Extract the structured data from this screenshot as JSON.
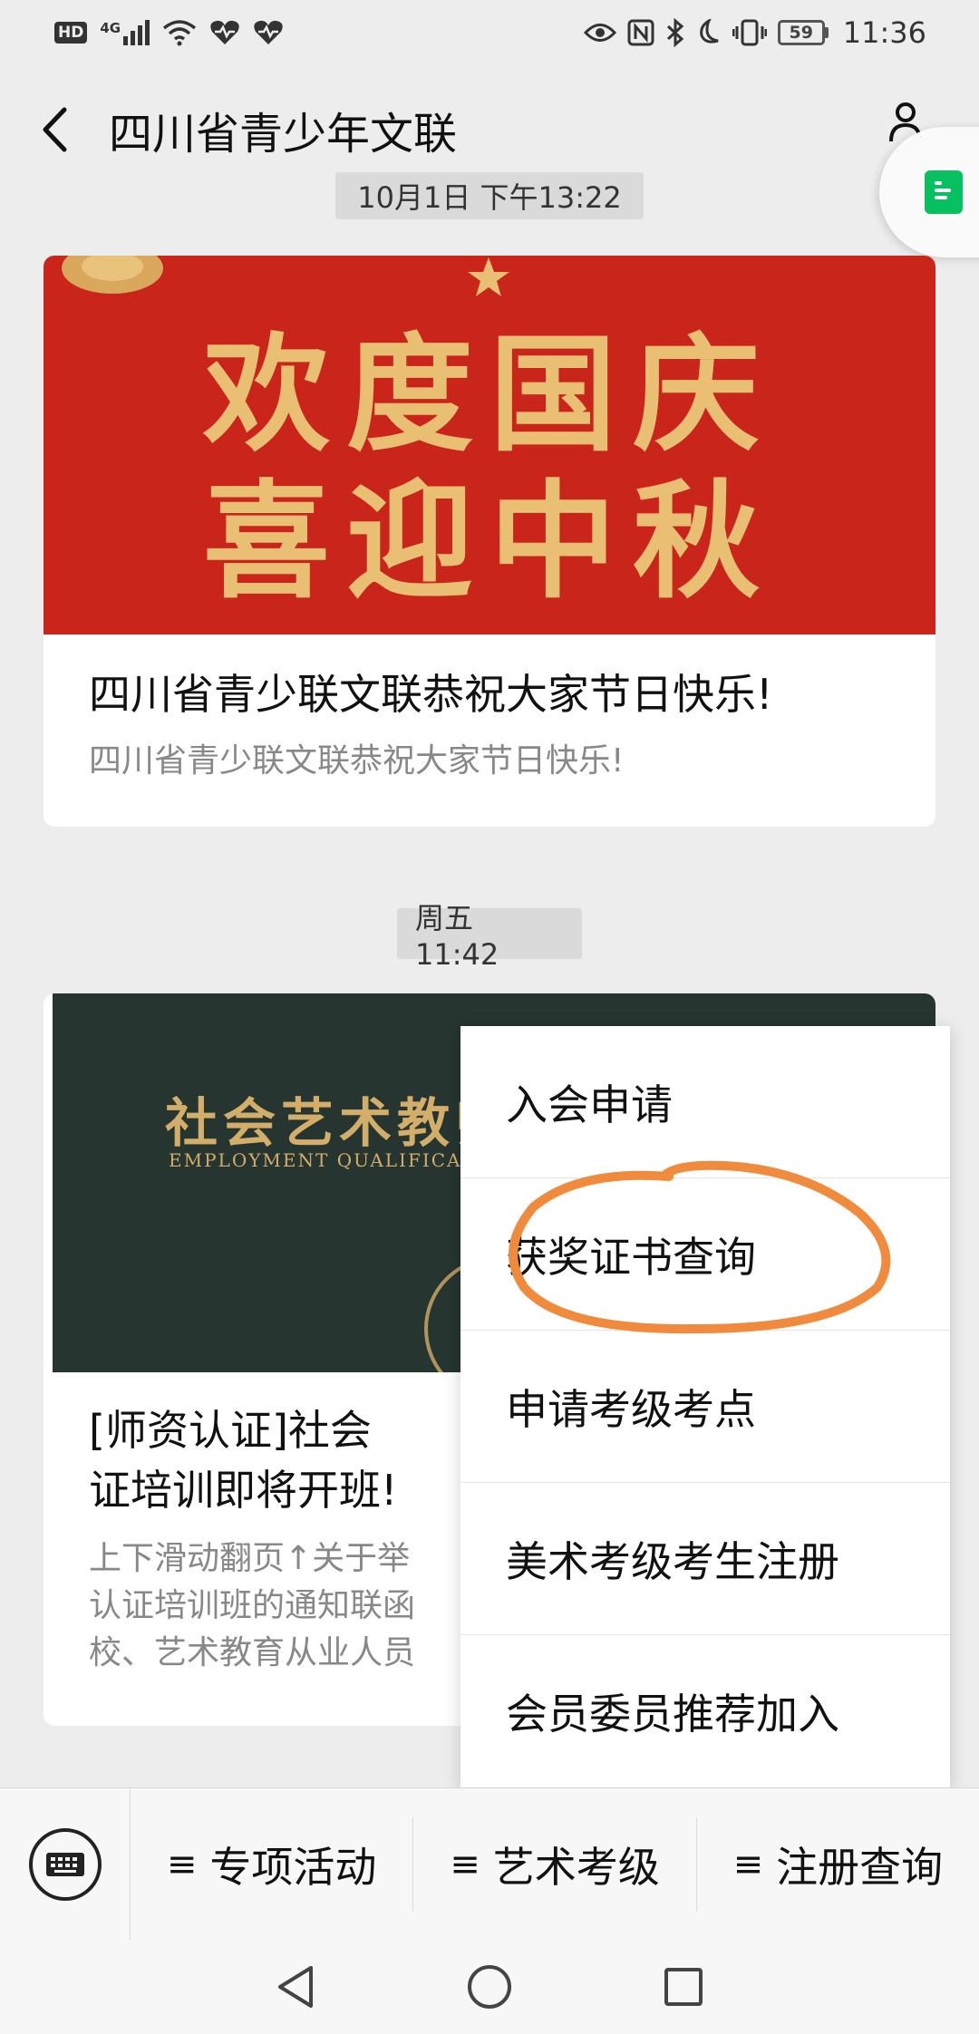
{
  "status_bar": {
    "hd": "HD",
    "network": "4G",
    "battery": "59",
    "time": "11:36"
  },
  "nav": {
    "title": "四川省青少年文联"
  },
  "messages": [
    {
      "timestamp": "10月1日 下午13:22",
      "banner_lines": [
        "欢度国庆",
        "喜迎中秋"
      ],
      "title": "四川省青少联文联恭祝大家节日快乐!",
      "desc": "四川省青少联文联恭祝大家节日快乐!"
    },
    {
      "timestamp": "周五 11:42",
      "banner_cn": "社会艺术教师",
      "banner_en": "EMPLOYMENT QUALIFICAT",
      "title_lines": [
        "[师资认证]社会",
        "证培训即将开班!"
      ],
      "desc_lines": [
        "上下滑动翻页↑关于举",
        "认证培训班的通知联函",
        "校、艺术教育从业人员"
      ]
    }
  ],
  "popup_menu": {
    "items": [
      "入会申请",
      "获奖证书查询",
      "申请考级考点",
      "美术考级考生注册",
      "会员委员推荐加入"
    ]
  },
  "bottom_menu": {
    "tabs": [
      "专项活动",
      "艺术考级",
      "注册查询"
    ],
    "hamburger": "≡"
  },
  "colors": {
    "banner_red": "#c9251a",
    "banner_gold": "#e9bf74",
    "annotation_orange": "#f08a3c",
    "accent_green": "#07c160"
  }
}
